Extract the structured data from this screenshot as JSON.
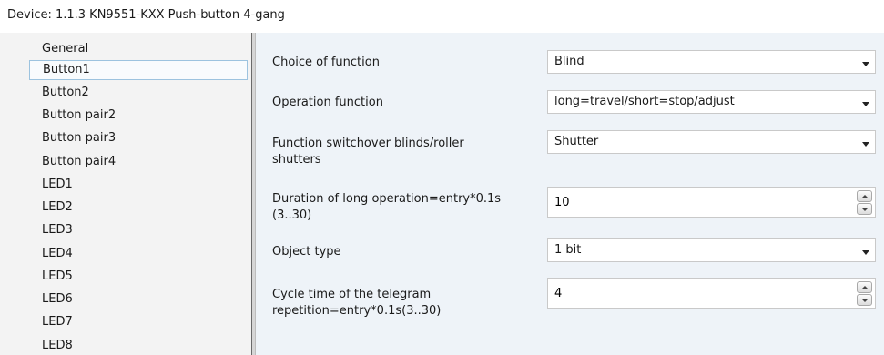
{
  "window": {
    "title": "Device: 1.1.3  KN9551-KXX Push-button 4-gang"
  },
  "sidebar": {
    "items": [
      {
        "label": "General"
      },
      {
        "label": "Button1",
        "selected": true
      },
      {
        "label": "Button2"
      },
      {
        "label": "Button pair2"
      },
      {
        "label": "Button pair3"
      },
      {
        "label": "Button pair4"
      },
      {
        "label": "LED1"
      },
      {
        "label": "LED2"
      },
      {
        "label": "LED3"
      },
      {
        "label": "LED4"
      },
      {
        "label": "LED5"
      },
      {
        "label": "LED6"
      },
      {
        "label": "LED7"
      },
      {
        "label": "LED8"
      }
    ]
  },
  "params": {
    "choice_of_function": {
      "label": "Choice of function",
      "value": "Blind",
      "control": "dropdown"
    },
    "operation_function": {
      "label": "Operation function",
      "value": "long=travel/short=stop/adjust",
      "control": "dropdown"
    },
    "function_switchover": {
      "label1": "Function switchover blinds/roller",
      "label2": "shutters",
      "value": "Shutter",
      "control": "dropdown"
    },
    "duration_long_operation": {
      "label1": "Duration of long operation=entry*0.1s",
      "label2": "(3..30)",
      "value": "10",
      "control": "spinner"
    },
    "object_type": {
      "label": "Object type",
      "value": "1 bit",
      "control": "dropdown"
    },
    "cycle_time": {
      "label1": "Cycle time of the telegram",
      "label2": "repetition=entry*0.1s(3..30)",
      "value": "4",
      "control": "spinner"
    }
  },
  "colors": {
    "sidebar_bg": "#f3f3f3",
    "main_bg": "#eef3f8",
    "selected_border": "#9cc3df"
  }
}
